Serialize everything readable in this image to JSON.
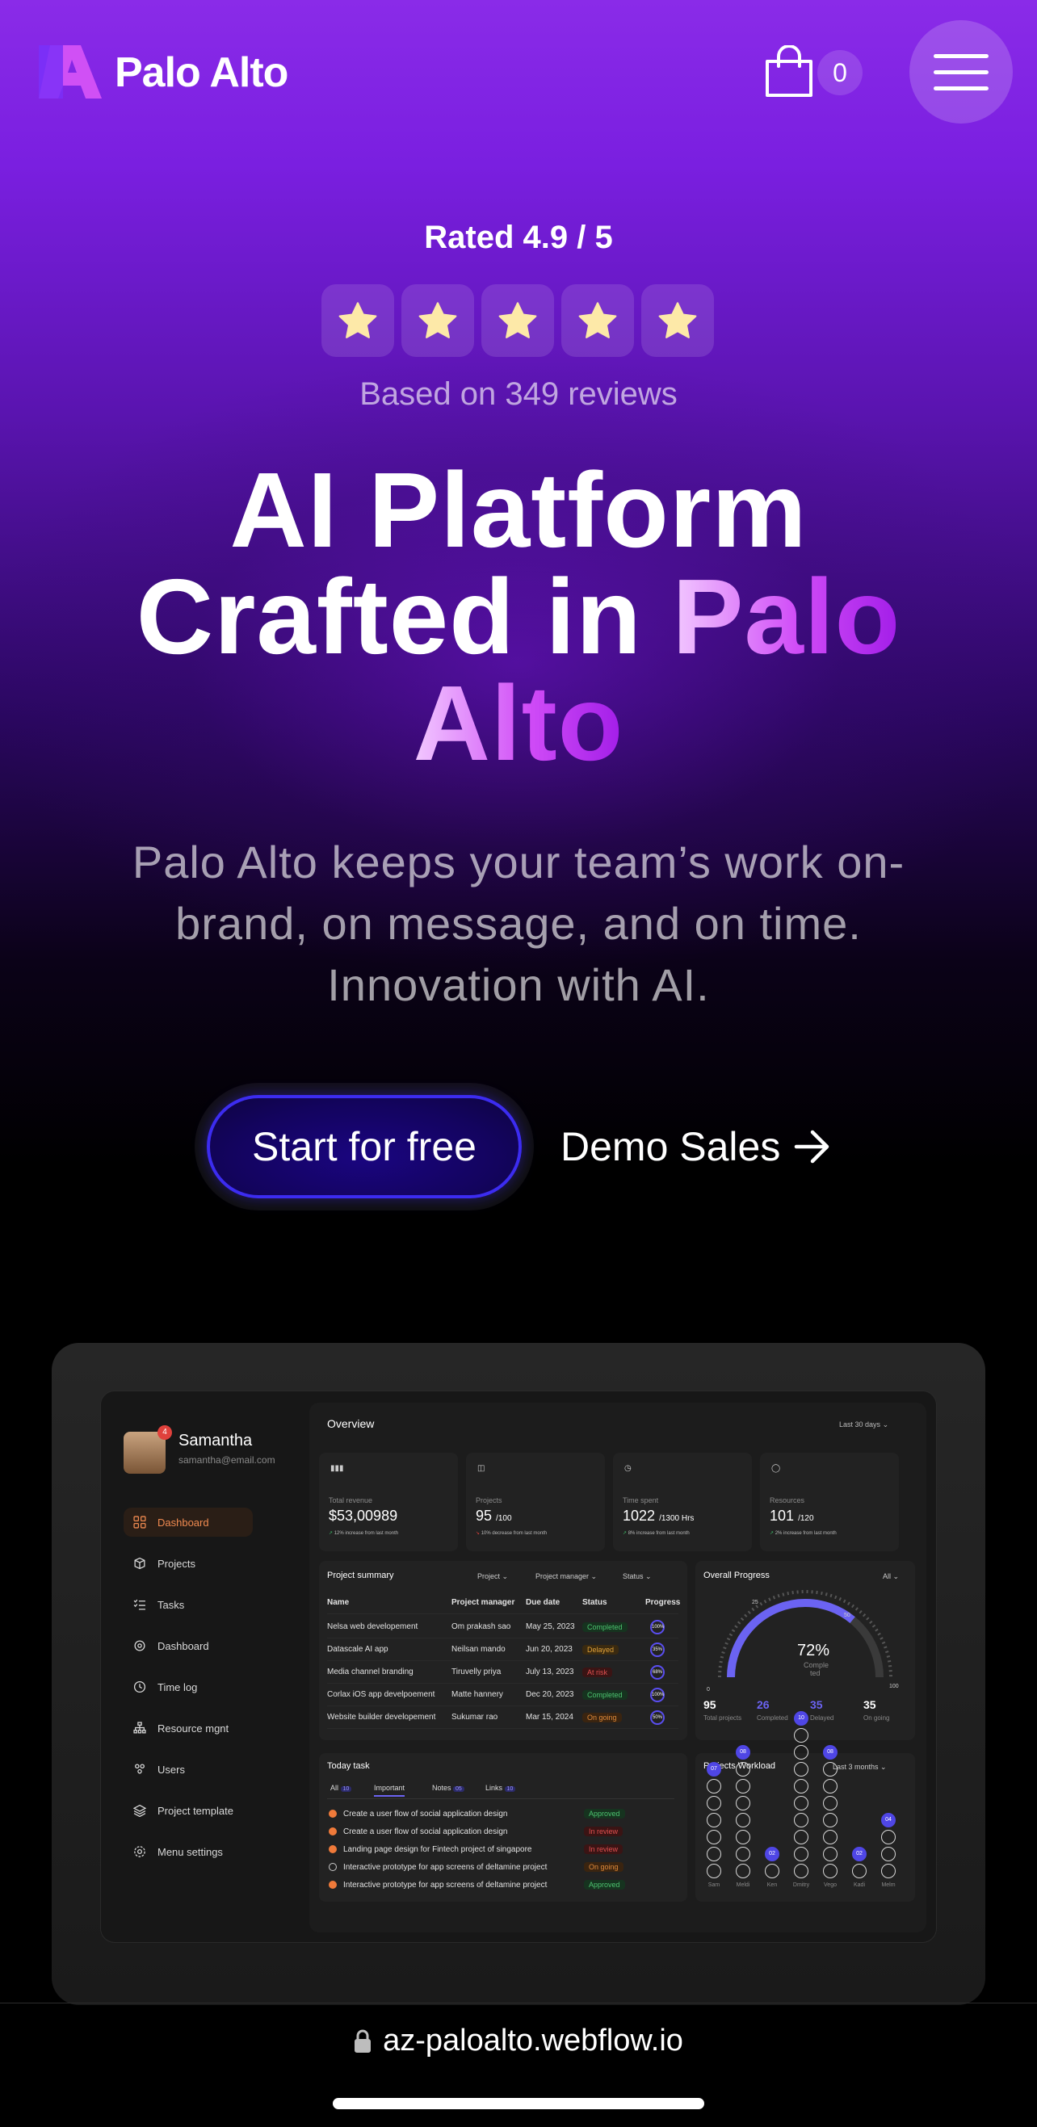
{
  "header": {
    "brand": "Palo Alto",
    "cart_count": "0",
    "colors": {
      "logo_left": "#7b2ff7",
      "logo_right": "#d050f5"
    }
  },
  "rating": {
    "rated_text": "Rated 4.9 / 5",
    "stars": 5,
    "star_color": "#fde9a8",
    "reviews_text": "Based on 349 reviews"
  },
  "hero": {
    "title_line1": "AI Platform",
    "title_line2_plain": "Crafted in ",
    "title_highlight_1": "Palo",
    "title_highlight_2": "Alto",
    "subtitle_line1": "Palo Alto keeps your team’s work on-",
    "subtitle_line2": "brand, on message, and on time.",
    "subtitle_line3": "Innovation with AI.",
    "primary_cta": "Start for free",
    "secondary_cta": "Demo Sales"
  },
  "dashboard": {
    "user_name": "Samantha",
    "user_email": "samantha@email.com",
    "notification_count": "4",
    "nav": [
      {
        "label": "Dashboard",
        "icon": "grid-icon"
      },
      {
        "label": "Projects",
        "icon": "box-icon"
      },
      {
        "label": "Tasks",
        "icon": "checklist-icon"
      },
      {
        "label": "Dashboard",
        "icon": "gear-chart-icon"
      },
      {
        "label": "Time log",
        "icon": "clock-icon"
      },
      {
        "label": "Resource mgnt",
        "icon": "hierarchy-icon"
      },
      {
        "label": "Users",
        "icon": "users-icon"
      },
      {
        "label": "Project template",
        "icon": "layers-icon"
      },
      {
        "label": "Menu settings",
        "icon": "settings-icon"
      }
    ],
    "overview_title": "Overview",
    "period": "Last 30 days",
    "stats": [
      {
        "label": "Total revenue",
        "value": "$53,00989",
        "suffix": "",
        "note": "12% increase from last month"
      },
      {
        "label": "Projects",
        "value": "95",
        "suffix": "/100",
        "note": "10% decrease from last month"
      },
      {
        "label": "Time spent",
        "value": "1022",
        "suffix": "/1300 Hrs",
        "note": "8% increase from last month"
      },
      {
        "label": "Resources",
        "value": "101",
        "suffix": "/120",
        "note": "2% increase from last month"
      }
    ],
    "project_summary": {
      "title": "Project summary",
      "filters": [
        "Project",
        "Project manager",
        "Status"
      ],
      "headers": [
        "Name",
        "Project manager",
        "Due date",
        "Status",
        "Progress"
      ],
      "rows": [
        {
          "name": "Nelsa web developement",
          "manager": "Om prakash sao",
          "due": "May 25, 2023",
          "status": "Completed",
          "progress": "100%"
        },
        {
          "name": "Datascale AI app",
          "manager": "Neilsan mando",
          "due": "Jun 20, 2023",
          "status": "Delayed",
          "progress": "35%"
        },
        {
          "name": "Media channel branding",
          "manager": "Tiruvelly priya",
          "due": "July 13, 2023",
          "status": "At risk",
          "progress": "68%"
        },
        {
          "name": "Corlax iOS app develpoement",
          "manager": "Matte hannery",
          "due": "Dec 20, 2023",
          "status": "Completed",
          "progress": "100%"
        },
        {
          "name": "Website builder developement",
          "manager": "Sukumar rao",
          "due": "Mar 15, 2024",
          "status": "On going",
          "progress": "50%"
        }
      ]
    },
    "overall_progress": {
      "title": "Overall Progress",
      "filter": "All",
      "percent": "72%",
      "caption_1": "Comple",
      "caption_2": "ted",
      "scale": [
        "0",
        "25",
        "50",
        "100"
      ],
      "totals": [
        {
          "value": "95",
          "label": "Total projects"
        },
        {
          "value": "26",
          "label": "Completed"
        },
        {
          "value": "35",
          "label": "Delayed"
        },
        {
          "value": "35",
          "label": "On going"
        }
      ]
    },
    "today_task": {
      "title": "Today task",
      "tabs": [
        {
          "label": "All",
          "count": "10"
        },
        {
          "label": "Important",
          "count": ""
        },
        {
          "label": "Notes",
          "count": "05"
        },
        {
          "label": "Links",
          "count": "10"
        }
      ],
      "items": [
        {
          "text": "Create a user flow of social application design",
          "status": "Approved"
        },
        {
          "text": "Create a user flow of social application design",
          "status": "In review"
        },
        {
          "text": "Landing page design for Fintech project of singapore",
          "status": "In review"
        },
        {
          "text": "Interactive prototype for app screens of deltamine project",
          "status": "On going"
        },
        {
          "text": "Interactive prototype for app screens of deltamine project",
          "status": "Approved"
        }
      ]
    },
    "workload": {
      "title": "Projects Workload",
      "filter": "Last 3 months",
      "people": [
        {
          "name": "Sam",
          "count": "07"
        },
        {
          "name": "Meldi",
          "count": "08"
        },
        {
          "name": "Ken",
          "count": "02"
        },
        {
          "name": "Dmitry",
          "count": "10"
        },
        {
          "name": "Vego",
          "count": "08"
        },
        {
          "name": "Kadi",
          "count": "02"
        },
        {
          "name": "Melm",
          "count": "04"
        }
      ]
    }
  },
  "browser": {
    "url": "az-paloalto.webflow.io"
  }
}
